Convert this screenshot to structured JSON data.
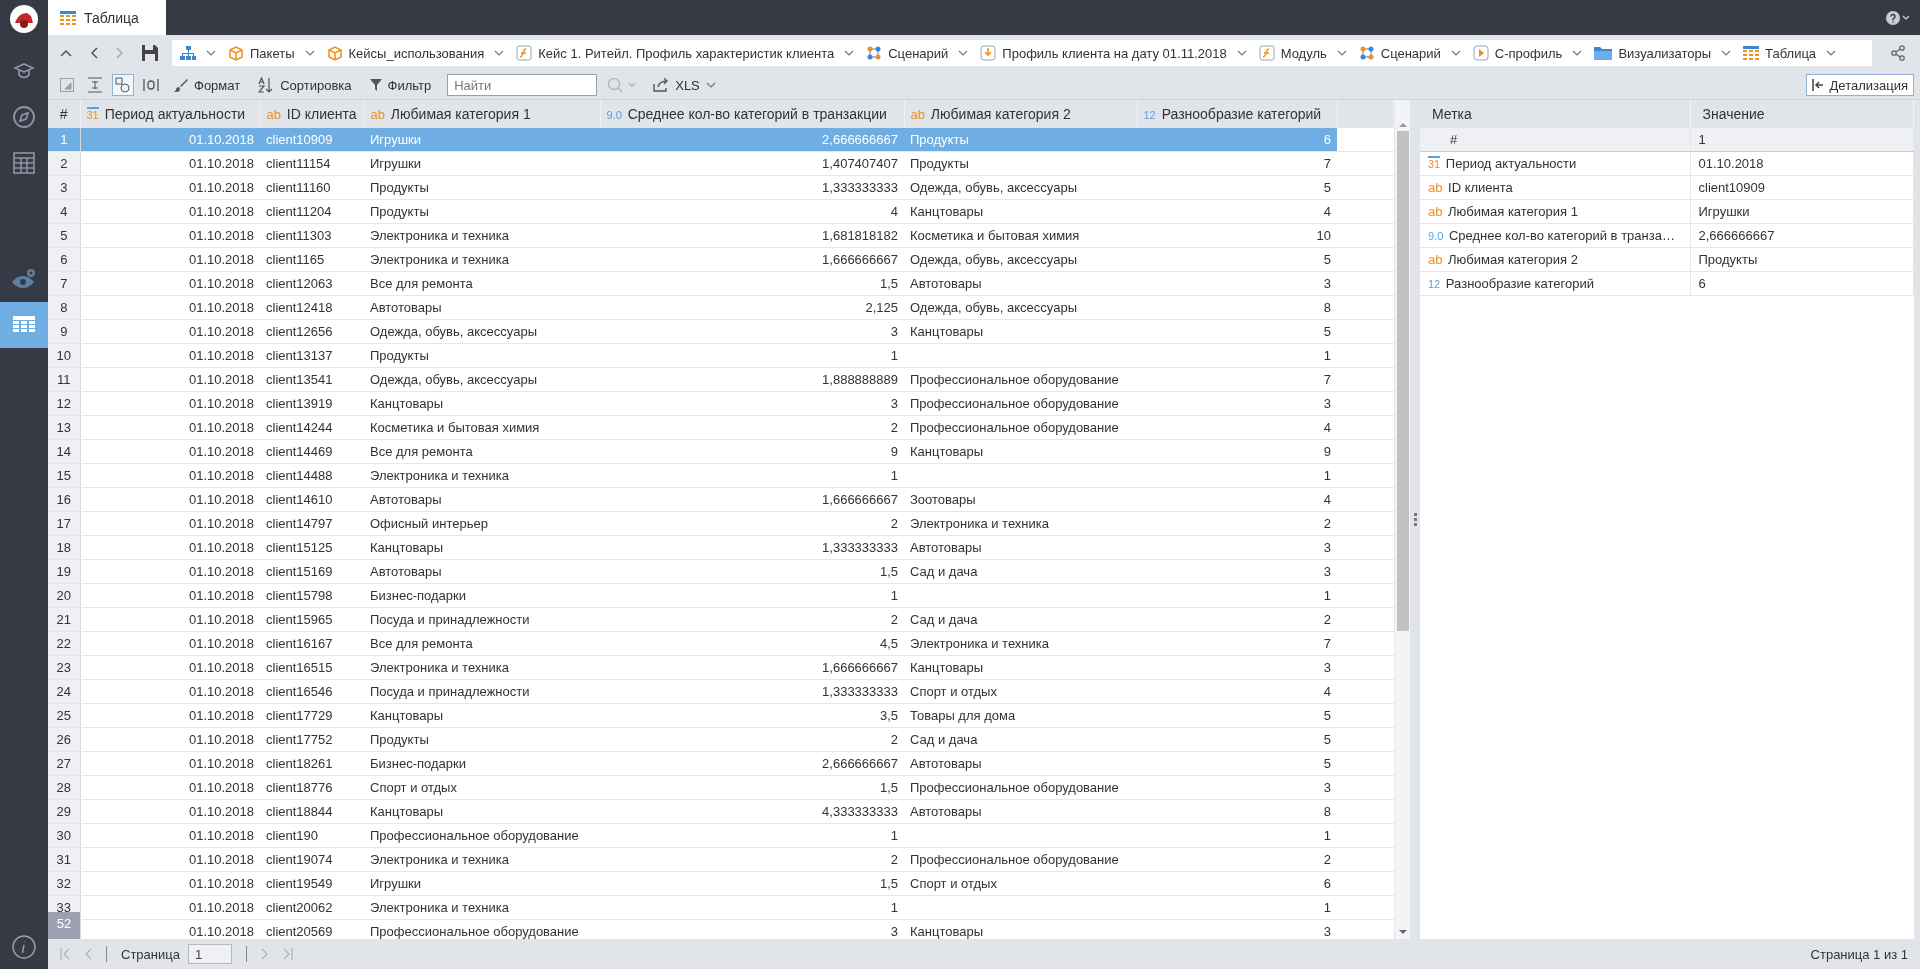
{
  "window": {
    "tab": "Таблица"
  },
  "sidebar": {
    "items": [
      {
        "kind": "cube",
        "selected": false
      },
      {
        "kind": "compass",
        "selected": false
      },
      {
        "kind": "calculator",
        "selected": false
      },
      {
        "kind": "eye-gear",
        "selected": false
      },
      {
        "kind": "table",
        "selected": true
      }
    ]
  },
  "breadcrumbs": [
    {
      "kind": "hierarchy"
    },
    {
      "kind": "package",
      "label": "Пакеты"
    },
    {
      "kind": "package",
      "label": "Кейсы_использования"
    },
    {
      "kind": "module",
      "label": "Кейс 1. Ритейл. Профиль характеристик клиента"
    },
    {
      "kind": "scenario",
      "label": "Сценарий"
    },
    {
      "kind": "profile",
      "label": "Профиль клиента на дату 01.11.2018"
    },
    {
      "kind": "module",
      "label": "Модуль"
    },
    {
      "kind": "scenario",
      "label": "Сценарий"
    },
    {
      "kind": "play",
      "label": "С-профиль"
    },
    {
      "kind": "folder",
      "label": "Визуализаторы"
    },
    {
      "kind": "table",
      "label": "Таблица"
    }
  ],
  "toolbar": {
    "view_buttons": [
      {
        "kind": "frame",
        "selected": false
      },
      {
        "kind": "row-height",
        "selected": false
      },
      {
        "kind": "shapes",
        "selected": true
      },
      {
        "kind": "columns",
        "selected": false
      }
    ],
    "format": "Формат",
    "sort": "Сортировка",
    "filter": "Фильтр",
    "search": {
      "placeholder": "Найти"
    },
    "export": "XLS",
    "detail": "Детализация"
  },
  "table": {
    "index_header": "#",
    "columns": [
      {
        "kind": "date",
        "icon": "31",
        "label": "Период актуальности"
      },
      {
        "kind": "text",
        "icon": "ab",
        "label": "ID клиента"
      },
      {
        "kind": "text",
        "icon": "ab",
        "label": "Любимая категория 1"
      },
      {
        "kind": "float",
        "icon": "9.0",
        "label": "Среднее кол-во категорий в транзакции"
      },
      {
        "kind": "text",
        "icon": "ab",
        "label": "Любимая категория 2"
      },
      {
        "kind": "int",
        "icon": "12",
        "label": "Разнообразие категорий"
      }
    ],
    "rows": [
      {
        "num": "1",
        "selected": true,
        "cells": [
          "01.10.2018",
          "client10909",
          "Игрушки",
          "2,666666667",
          "Продукты",
          "6"
        ]
      },
      {
        "num": "2",
        "selected": false,
        "cells": [
          "01.10.2018",
          "client11154",
          "Игрушки",
          "1,407407407",
          "Продукты",
          "7"
        ]
      },
      {
        "num": "3",
        "selected": false,
        "cells": [
          "01.10.2018",
          "client11160",
          "Продукты",
          "1,333333333",
          "Одежда, обувь, аксессуары",
          "5"
        ]
      },
      {
        "num": "4",
        "selected": false,
        "cells": [
          "01.10.2018",
          "client11204",
          "Продукты",
          "4",
          "Канцтовары",
          "4"
        ]
      },
      {
        "num": "5",
        "selected": false,
        "cells": [
          "01.10.2018",
          "client11303",
          "Электроника и техника",
          "1,681818182",
          "Косметика и бытовая химия",
          "10"
        ]
      },
      {
        "num": "6",
        "selected": false,
        "cells": [
          "01.10.2018",
          "client1165",
          "Электроника и техника",
          "1,666666667",
          "Одежда, обувь, аксессуары",
          "5"
        ]
      },
      {
        "num": "7",
        "selected": false,
        "cells": [
          "01.10.2018",
          "client12063",
          "Все для ремонта",
          "1,5",
          "Автотовары",
          "3"
        ]
      },
      {
        "num": "8",
        "selected": false,
        "cells": [
          "01.10.2018",
          "client12418",
          "Автотовары",
          "2,125",
          "Одежда, обувь, аксессуары",
          "8"
        ]
      },
      {
        "num": "9",
        "selected": false,
        "cells": [
          "01.10.2018",
          "client12656",
          "Одежда, обувь, аксессуары",
          "3",
          "Канцтовары",
          "5"
        ]
      },
      {
        "num": "10",
        "selected": false,
        "cells": [
          "01.10.2018",
          "client13137",
          "Продукты",
          "1",
          null,
          "1"
        ]
      },
      {
        "num": "11",
        "selected": false,
        "cells": [
          "01.10.2018",
          "client13541",
          "Одежда, обувь, аксессуары",
          "1,888888889",
          "Профессиональное оборудование",
          "7"
        ]
      },
      {
        "num": "12",
        "selected": false,
        "cells": [
          "01.10.2018",
          "client13919",
          "Канцтовары",
          "3",
          "Профессиональное оборудование",
          "3"
        ]
      },
      {
        "num": "13",
        "selected": false,
        "cells": [
          "01.10.2018",
          "client14244",
          "Косметика и бытовая химия",
          "2",
          "Профессиональное оборудование",
          "4"
        ]
      },
      {
        "num": "14",
        "selected": false,
        "cells": [
          "01.10.2018",
          "client14469",
          "Все для ремонта",
          "9",
          "Канцтовары",
          "9"
        ]
      },
      {
        "num": "15",
        "selected": false,
        "cells": [
          "01.10.2018",
          "client14488",
          "Электроника и техника",
          "1",
          null,
          "1"
        ]
      },
      {
        "num": "16",
        "selected": false,
        "cells": [
          "01.10.2018",
          "client14610",
          "Автотовары",
          "1,666666667",
          "Зоотовары",
          "4"
        ]
      },
      {
        "num": "17",
        "selected": false,
        "cells": [
          "01.10.2018",
          "client14797",
          "Офисный интерьер",
          "2",
          "Электроника и техника",
          "2"
        ]
      },
      {
        "num": "18",
        "selected": false,
        "cells": [
          "01.10.2018",
          "client15125",
          "Канцтовары",
          "1,333333333",
          "Автотовары",
          "3"
        ]
      },
      {
        "num": "19",
        "selected": false,
        "cells": [
          "01.10.2018",
          "client15169",
          "Автотовары",
          "1,5",
          "Сад и дача",
          "3"
        ]
      },
      {
        "num": "20",
        "selected": false,
        "cells": [
          "01.10.2018",
          "client15798",
          "Бизнес-подарки",
          "1",
          null,
          "1"
        ]
      },
      {
        "num": "21",
        "selected": false,
        "cells": [
          "01.10.2018",
          "client15965",
          "Посуда и принадлежности",
          "2",
          "Сад и дача",
          "2"
        ]
      },
      {
        "num": "22",
        "selected": false,
        "cells": [
          "01.10.2018",
          "client16167",
          "Все для ремонта",
          "4,5",
          "Электроника и техника",
          "7"
        ]
      },
      {
        "num": "23",
        "selected": false,
        "cells": [
          "01.10.2018",
          "client16515",
          "Электроника и техника",
          "1,666666667",
          "Канцтовары",
          "3"
        ]
      },
      {
        "num": "24",
        "selected": false,
        "cells": [
          "01.10.2018",
          "client16546",
          "Посуда и принадлежности",
          "1,333333333",
          "Спорт и отдых",
          "4"
        ]
      },
      {
        "num": "25",
        "selected": false,
        "cells": [
          "01.10.2018",
          "client17729",
          "Канцтовары",
          "3,5",
          "Товары для дома",
          "5"
        ]
      },
      {
        "num": "26",
        "selected": false,
        "cells": [
          "01.10.2018",
          "client17752",
          "Продукты",
          "2",
          "Сад и дача",
          "5"
        ]
      },
      {
        "num": "27",
        "selected": false,
        "cells": [
          "01.10.2018",
          "client18261",
          "Бизнес-подарки",
          "2,666666667",
          "Автотовары",
          "5"
        ]
      },
      {
        "num": "28",
        "selected": false,
        "cells": [
          "01.10.2018",
          "client18776",
          "Спорт и отдых",
          "1,5",
          "Профессиональное оборудование",
          "3"
        ]
      },
      {
        "num": "29",
        "selected": false,
        "cells": [
          "01.10.2018",
          "client18844",
          "Канцтовары",
          "4,333333333",
          "Автотовары",
          "8"
        ]
      },
      {
        "num": "30",
        "selected": false,
        "cells": [
          "01.10.2018",
          "client190",
          "Профессиональное оборудование",
          "1",
          null,
          "1"
        ]
      },
      {
        "num": "31",
        "selected": false,
        "cells": [
          "01.10.2018",
          "client19074",
          "Электроника и техника",
          "2",
          "Профессиональное оборудование",
          "2"
        ]
      },
      {
        "num": "32",
        "selected": false,
        "cells": [
          "01.10.2018",
          "client19549",
          "Игрушки",
          "1,5",
          "Спорт и отдых",
          "6"
        ]
      },
      {
        "num": "33",
        "selected": false,
        "cells": [
          "01.10.2018",
          "client20062",
          "Электроника и техника",
          "1",
          null,
          "1"
        ]
      },
      {
        "selected": false,
        "cells": [
          "01.10.2018",
          "client20569",
          "Профессиональное оборудование",
          "3",
          "Канцтовары",
          "3"
        ]
      }
    ],
    "row_count": "52"
  },
  "detail": {
    "columns": [
      "Метка",
      "Значение"
    ],
    "rows": [
      {
        "kind": "index",
        "label": "#",
        "value": "1"
      },
      {
        "kind": "date",
        "icon": "31",
        "label": "Период актуальности",
        "value": "01.10.2018"
      },
      {
        "kind": "text",
        "icon": "ab",
        "label": "ID клиента",
        "value": "client10909"
      },
      {
        "kind": "text",
        "icon": "ab",
        "label": "Любимая категория 1",
        "value": "Игрушки"
      },
      {
        "kind": "float",
        "icon": "9.0",
        "label": "Среднее кол-во категорий в транза…",
        "value": "2,666666667"
      },
      {
        "kind": "text",
        "icon": "ab",
        "label": "Любимая категория 2",
        "value": "Продукты"
      },
      {
        "kind": "int",
        "icon": "12",
        "label": "Разнообразие категорий",
        "value": "6"
      }
    ]
  },
  "pager": {
    "label": "Страница",
    "value": "1",
    "summary": "Страница 1 из 1"
  }
}
